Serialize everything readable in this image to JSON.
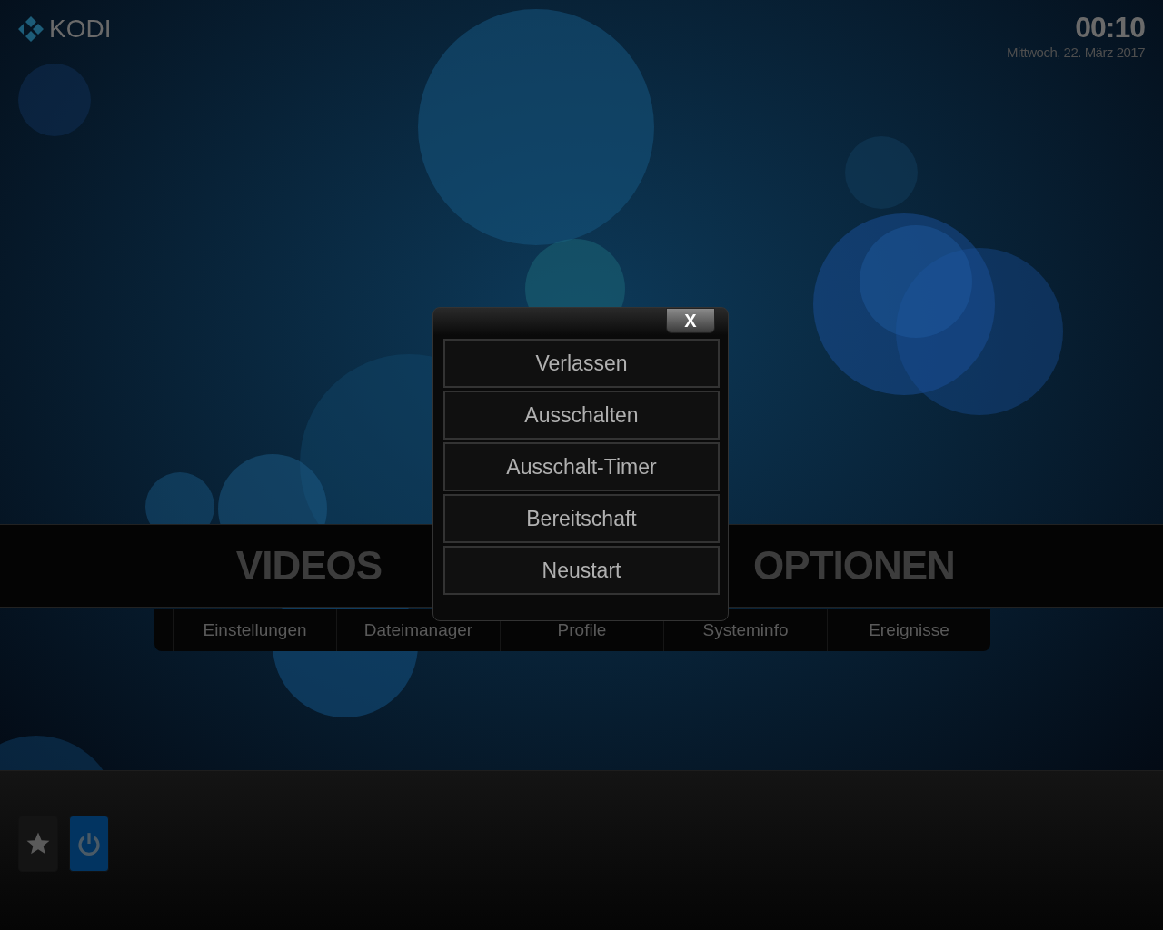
{
  "header": {
    "logo_text": "KODI",
    "time": "00:10",
    "date": "Mittwoch, 22. März 2017"
  },
  "main_menu": [
    {
      "label": "VIDEOS"
    },
    {
      "label": "OPTIONEN"
    }
  ],
  "sub_menu": [
    {
      "label": "Einstellungen"
    },
    {
      "label": "Dateimanager"
    },
    {
      "label": "Profile"
    },
    {
      "label": "Systeminfo"
    },
    {
      "label": "Ereignisse"
    }
  ],
  "bottom_buttons": [
    {
      "kind": "favourites",
      "selected": false
    },
    {
      "kind": "power",
      "selected": true
    }
  ],
  "dialog": {
    "close_label": "X",
    "options": [
      {
        "label": "Verlassen"
      },
      {
        "label": "Ausschalten"
      },
      {
        "label": "Ausschalt-Timer"
      },
      {
        "label": "Bereitschaft"
      },
      {
        "label": "Neustart"
      }
    ]
  }
}
